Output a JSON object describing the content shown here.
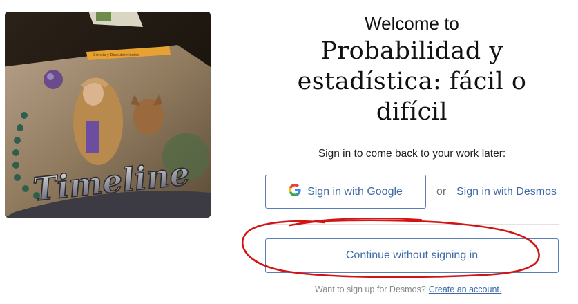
{
  "cover": {
    "title_word": "Timeline",
    "badge_text": "Ciencia y Descubrimientos"
  },
  "header": {
    "welcome": "Welcome to",
    "title_lines": [
      "Probabilidad y",
      "estadística: fácil o",
      "difícil"
    ]
  },
  "auth": {
    "prompt": "Sign in to come back to your work later:",
    "google_label": "Sign in with Google",
    "or_label": "or",
    "desmos_label": "Sign in with Desmos",
    "continue_label": "Continue without signing in",
    "signup_prompt": "Want to sign up for Desmos?",
    "signup_link": "Create an account."
  },
  "colors": {
    "link_blue": "#3d6ba8",
    "border_blue": "#5a7fb6",
    "annotation_red": "#d21414"
  },
  "icons": {
    "google": "google-g-icon"
  }
}
